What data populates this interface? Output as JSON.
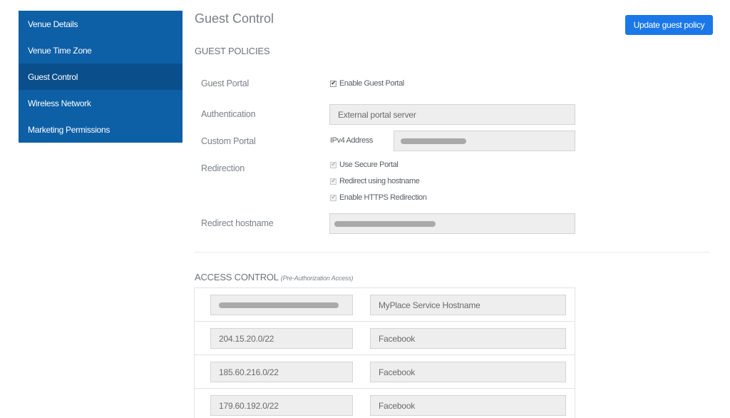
{
  "sidebar": {
    "items": [
      {
        "label": "Venue Details",
        "active": false
      },
      {
        "label": "Venue Time Zone",
        "active": false
      },
      {
        "label": "Guest Control",
        "active": true
      },
      {
        "label": "Wireless Network",
        "active": false
      },
      {
        "label": "Marketing Permissions",
        "active": false
      }
    ]
  },
  "header": {
    "title": "Guest Control",
    "update_button": "Update guest policy"
  },
  "guest_policies": {
    "section_title": "GUEST POLICIES",
    "guest_portal": {
      "label": "Guest Portal",
      "checkbox_label": "Enable Guest Portal",
      "checked": true
    },
    "authentication": {
      "label": "Authentication",
      "value": "External portal server"
    },
    "custom_portal": {
      "label": "Custom Portal",
      "sublabel": "IPv4 Address",
      "value_redacted": true
    },
    "redirection": {
      "label": "Redirection",
      "options": [
        {
          "label": "Use Secure Portal",
          "checked": true,
          "disabled": true
        },
        {
          "label": "Redirect using hostname",
          "checked": true,
          "disabled": true
        },
        {
          "label": "Enable HTTPS Redirection",
          "checked": true,
          "disabled": true
        }
      ]
    },
    "redirect_hostname": {
      "label": "Redirect hostname",
      "value_redacted": true
    }
  },
  "access_control": {
    "section_title": "ACCESS CONTROL",
    "section_subtitle": "(Pre-Authorization Access)",
    "rows": [
      {
        "address": "",
        "address_redacted": true,
        "name": "MyPlace Service Hostname"
      },
      {
        "address": "204.15.20.0/22",
        "address_redacted": false,
        "name": "Facebook"
      },
      {
        "address": "185.60.216.0/22",
        "address_redacted": false,
        "name": "Facebook"
      },
      {
        "address": "179.60.192.0/22",
        "address_redacted": false,
        "name": "Facebook"
      }
    ]
  }
}
